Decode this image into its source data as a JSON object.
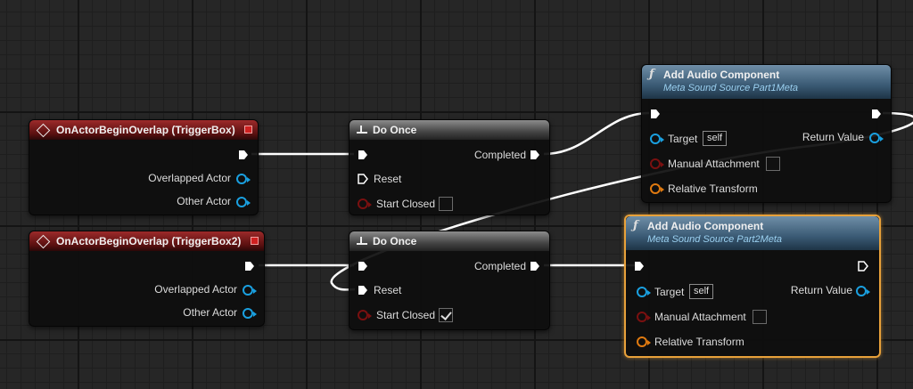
{
  "event_nodes": [
    {
      "title": "OnActorBeginOverlap (TriggerBox)",
      "pins": [
        "Overlapped Actor",
        "Other Actor"
      ]
    },
    {
      "title": "OnActorBeginOverlap (TriggerBox2)",
      "pins": [
        "Overlapped Actor",
        "Other Actor"
      ]
    }
  ],
  "do_once_nodes": [
    {
      "title": "Do Once",
      "output_label": "Completed",
      "reset_label": "Reset",
      "start_closed_label": "Start Closed",
      "start_closed_checked": false
    },
    {
      "title": "Do Once",
      "output_label": "Completed",
      "reset_label": "Reset",
      "start_closed_label": "Start Closed",
      "start_closed_checked": true
    }
  ],
  "audio_nodes": [
    {
      "title": "Add Audio Component",
      "subtitle": "Meta Sound Source Part1Meta",
      "target_label": "Target",
      "target_value": "self",
      "return_label": "Return Value",
      "manual_attachment_label": "Manual Attachment",
      "relative_transform_label": "Relative Transform",
      "selected": false
    },
    {
      "title": "Add Audio Component",
      "subtitle": "Meta Sound Source Part2Meta",
      "target_label": "Target",
      "target_value": "self",
      "return_label": "Return Value",
      "manual_attachment_label": "Manual Attachment",
      "relative_transform_label": "Relative Transform",
      "selected": true
    }
  ],
  "colors": {
    "exec_wire": "#ffffff",
    "event_header": "#9c2a2a",
    "function_header": "#3a5a74",
    "object_pin": "#1aa0e0",
    "bool_pin": "#7a1010",
    "struct_pin": "#e07a10",
    "selection": "#e8a13a"
  }
}
